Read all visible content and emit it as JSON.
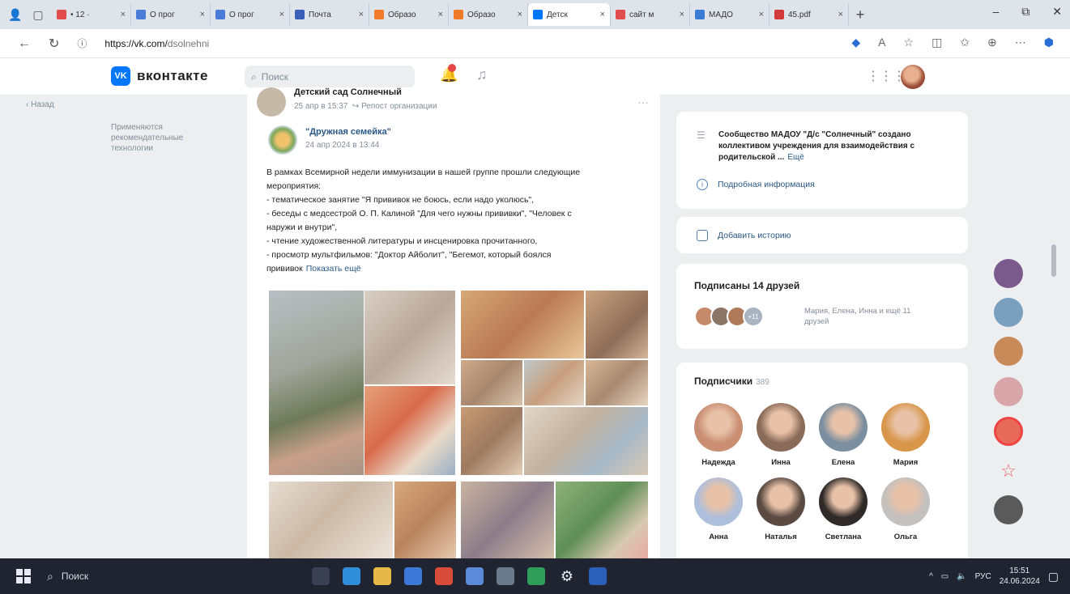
{
  "browser": {
    "tabs": [
      {
        "label": "• 12 ·",
        "color": "#e34c4c"
      },
      {
        "label": "О прог",
        "color": "#4a7bd6"
      },
      {
        "label": "О прог",
        "color": "#4a7bd6"
      },
      {
        "label": "Почта",
        "color": "#3a5fb8"
      },
      {
        "label": "Образо",
        "color": "#f07a2a"
      },
      {
        "label": "Образо",
        "color": "#f07a2a"
      },
      {
        "label": "Детск",
        "color": "#0077ff",
        "active": true
      },
      {
        "label": "сайт м",
        "color": "#e34c4c"
      },
      {
        "label": "МАДО",
        "color": "#3a7bd6"
      },
      {
        "label": "45.pdf",
        "color": "#d23a3a"
      }
    ],
    "tab_close": "×",
    "new_tab": "+",
    "window_controls": {
      "minimize": "–",
      "restore": "⧉",
      "close": "✕"
    },
    "url_host": "https://vk.com/",
    "url_path": "dsolnehni"
  },
  "vk_header": {
    "logo_mark": "VK",
    "logo_text": "вконтакте",
    "search_placeholder": "Поиск"
  },
  "left_menu": {
    "back_label": "Назад",
    "recommend_label": "Применяются рекомендательные технологии"
  },
  "post": {
    "group_name": "Детский сад Солнечный",
    "group_date": "25 апр в 15:37",
    "group_tag": "Репост организации",
    "original_name": "\"Дружная семейка\"",
    "original_date": "24 апр 2024 в 13:44",
    "text_lines": [
      "В рамках Всемирной недели иммунизации в нашей группе прошли следующие",
      "мероприятия:",
      "- тематическое занятие \"Я прививок не боюсь, если надо уколюсь\",",
      "- беседы с медсестрой О. П. Калиной \"Для чего нужны прививки\", \"Человек с",
      "наружи и внутри\",",
      "- чтение художественной литературы и инсценировка прочитанного,",
      "- просмотр мультфильмов: \"Доктор Айболит\", \"Бегемот, который боялся"
    ],
    "last_line": "прививок",
    "show_more": "Показать ещё"
  },
  "about": {
    "text": "Сообщество МАДОУ \"Д/с \"Солнечный\" создано коллективом учреждения для взаимодействия с родительской ...",
    "more": "Ещё",
    "details_link": "Подробная информация",
    "add_story": "Добавить историю"
  },
  "friends": {
    "title": "Подписаны 14 друзей",
    "summary": "Мария, Елена, Инна и ещё 11 друзей",
    "extra_badge": "+11"
  },
  "subscribers": {
    "title": "Подписчики",
    "count": "389",
    "people": [
      {
        "name": "Надежда",
        "color": "#c98e73"
      },
      {
        "name": "Инна",
        "color": "#8a6a58"
      },
      {
        "name": "Елена",
        "color": "#7b8fa0"
      },
      {
        "name": "Мария",
        "color": "#d8964a"
      },
      {
        "name": "Анна",
        "color": "#aebfdc"
      },
      {
        "name": "Наталья",
        "color": "#5a4a42"
      },
      {
        "name": "Светлана",
        "color": "#2f2a28"
      },
      {
        "name": "Ольга",
        "color": "#c4c0bd"
      }
    ]
  },
  "taskbar": {
    "search_label": "Поиск",
    "lang": "РУС",
    "time": "15:51",
    "date": "24.06.2024"
  },
  "colors": {
    "vk_blue": "#0077ff",
    "link": "#2a5885",
    "muted": "#818c99",
    "page_bg": "#edeef0"
  }
}
